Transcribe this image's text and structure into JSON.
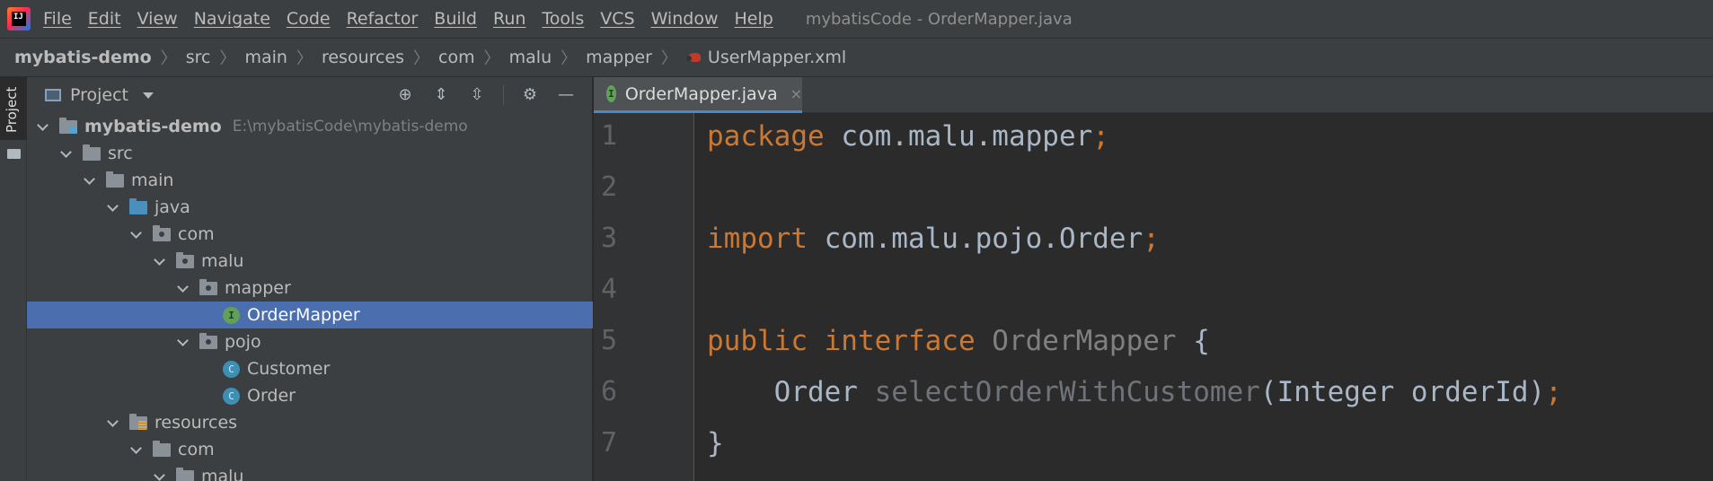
{
  "app": {
    "logo_text": "IJ",
    "menu": [
      "File",
      "Edit",
      "View",
      "Navigate",
      "Code",
      "Refactor",
      "Build",
      "Run",
      "Tools",
      "VCS",
      "Window",
      "Help"
    ],
    "window_title": "mybatisCode - OrderMapper.java"
  },
  "breadcrumb": [
    "mybatis-demo",
    "src",
    "main",
    "resources",
    "com",
    "malu",
    "mapper",
    "UserMapper.xml"
  ],
  "left_stripe": {
    "label": "Project"
  },
  "project_panel": {
    "title": "Project",
    "tree": [
      {
        "label": "mybatis-demo",
        "path": "E:\\mybatisCode\\mybatis-demo"
      },
      {
        "label": "src"
      },
      {
        "label": "main"
      },
      {
        "label": "java"
      },
      {
        "label": "com"
      },
      {
        "label": "malu"
      },
      {
        "label": "mapper"
      },
      {
        "label": "OrderMapper",
        "icon_text": "I"
      },
      {
        "label": "pojo"
      },
      {
        "label": "Customer",
        "icon_text": "C"
      },
      {
        "label": "Order",
        "icon_text": "C"
      },
      {
        "label": "resources"
      },
      {
        "label": "com"
      },
      {
        "label": "malu"
      }
    ]
  },
  "editor": {
    "tab": {
      "label": "OrderMapper.java",
      "icon_text": "I",
      "close": "×"
    },
    "line_numbers": [
      "1",
      "2",
      "3",
      "4",
      "5",
      "6",
      "7"
    ],
    "code": {
      "l1_kw": "package",
      "l1_rest": " com.malu.mapper",
      "l1_semi": ";",
      "l3_kw": "import",
      "l3_rest": " com.malu.pojo.Order",
      "l3_semi": ";",
      "l5_kw1": "public",
      "l5_kw2": " interface",
      "l5_name": " OrderMapper",
      "l5_brace": " {",
      "l6_type": "    Order",
      "l6_method": " selectOrderWithCustomer",
      "l6_params": "(Integer orderId)",
      "l6_semi": ";",
      "l7": "}"
    }
  },
  "colors": {
    "keyword": "#cc7832",
    "selection": "#4b6eaf",
    "tab_underline": "#4a88c7"
  }
}
